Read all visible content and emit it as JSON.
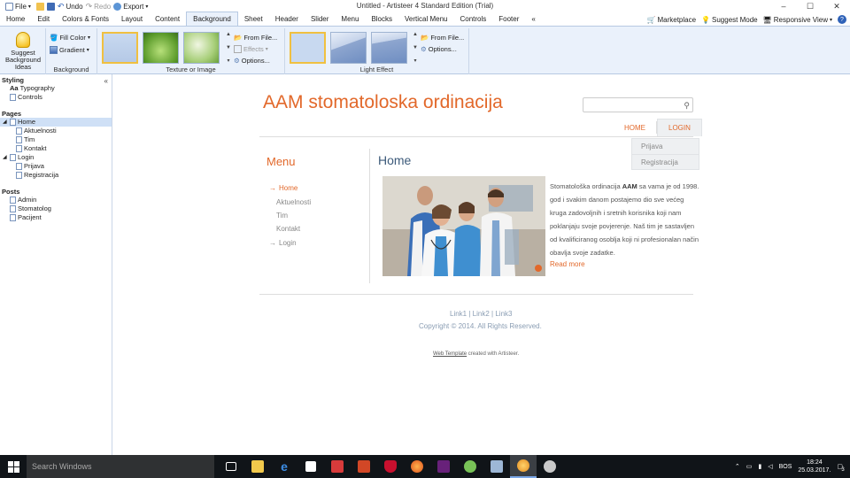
{
  "quick_access": {
    "file": "File",
    "undo": "Undo",
    "redo": "Redo",
    "export": "Export"
  },
  "window": {
    "title": "Untitled - Artisteer 4 Standard Edition (Trial)",
    "minimize": "–",
    "maximize": "☐",
    "close": "✕"
  },
  "ribbon_tabs": [
    "Home",
    "Edit",
    "Colors & Fonts",
    "Layout",
    "Content",
    "Background",
    "Sheet",
    "Header",
    "Slider",
    "Menu",
    "Blocks",
    "Vertical Menu",
    "Controls",
    "Footer",
    "«"
  ],
  "ribbon_right": {
    "marketplace": "Marketplace",
    "suggest_mode": "Suggest Mode",
    "responsive_view": "Responsive View",
    "help": "?"
  },
  "ribbon": {
    "suggest": "Suggest Background Ideas",
    "fill_color": "Fill Color",
    "gradient": "Gradient",
    "group_background": "Background",
    "group_texture": "Texture or Image",
    "group_light": "Light Effect",
    "from_file": "From File...",
    "effects": "Effects",
    "options": "Options...",
    "from_file2": "From File...",
    "options2": "Options..."
  },
  "left_panel": {
    "collapse": "«",
    "styling": "Styling",
    "typography": "Typography",
    "controls": "Controls",
    "pages": "Pages",
    "home": "Home",
    "aktuelnosti": "Aktuelnosti",
    "tim": "Tim",
    "kontakt": "Kontakt",
    "login": "Login",
    "prijava": "Prijava",
    "registracija": "Registracija",
    "posts": "Posts",
    "admin": "Admin",
    "stomatolog": "Stomatolog",
    "pacijent": "Pacijent"
  },
  "site": {
    "title": "AAM stomatoloska ordinacija",
    "nav_home": "HOME",
    "nav_login": "LOGIN",
    "submenu": [
      "Prijava",
      "Registracija"
    ],
    "menu_title": "Menu",
    "menu_items": [
      "Home",
      "Aktuelnosti",
      "Tim",
      "Kontakt",
      "Login"
    ],
    "page_title": "Home",
    "article_pre": "Stomatološka ordinacija ",
    "article_bold": "AAM",
    "article_post": " sa vama je od 1998. god i svakim danom postajemo dio sve većeg kruga zadovoljnih i sretnih korisnika koji nam poklanjaju svoje povjerenje. Naš tim je sastavljen od kvalificiranog osoblja koji ni profesionalan način obavlja svoje zadatke.",
    "read_more": "Read more",
    "footer_link1": "Link1",
    "footer_link2": "Link2",
    "footer_link3": "Link3",
    "footer_sep": "|",
    "copyright": "Copyright © 2014. All Rights Reserved.",
    "credit_link": "Web Template",
    "credit_text": " created with Artisteer."
  },
  "taskbar": {
    "search_placeholder": "Search Windows",
    "language": "BOS",
    "time": "18:24",
    "date": "25.03.2017.",
    "notifications": "3"
  },
  "colors": {
    "accent_orange": "#e2682a",
    "ribbon_bg": "#eaf1fb",
    "taskbar_bg": "#101418"
  }
}
